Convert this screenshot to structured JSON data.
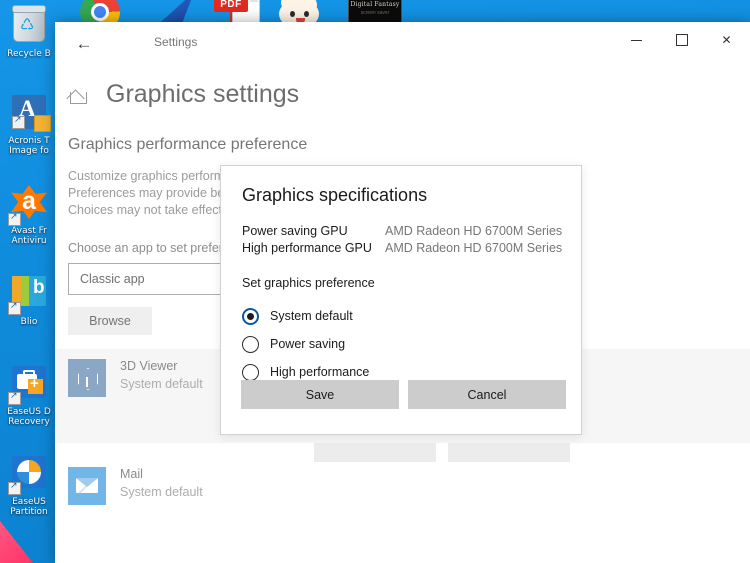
{
  "desktop": {
    "icons": [
      {
        "name": "Recycle Bin",
        "label": "Recycle B",
        "shape": "recycle-bin-icon"
      },
      {
        "name": "Acronis True Image",
        "label": "Acronis T\nImage fo",
        "shape": "acronis-icon"
      },
      {
        "name": "Avast Free Antivirus",
        "label": "Avast Fr\nAntiviru",
        "shape": "avast-icon"
      },
      {
        "name": "Blio",
        "label": "Blio",
        "shape": "blio-icon"
      },
      {
        "name": "EaseUS Data Recovery",
        "label": "EaseUS D\nRecovery",
        "shape": "easeus-recovery-icon"
      },
      {
        "name": "EaseUS Partition",
        "label": "EaseUS\nPartition",
        "shape": "easeus-partition-icon"
      }
    ],
    "top_icons": [
      {
        "name": "Google Chrome",
        "shape": "chrome-icon"
      },
      {
        "name": "Shark fin",
        "shape": "fin-icon"
      },
      {
        "name": "PDF document",
        "shape": "pdf-icon",
        "label": "PDF"
      },
      {
        "name": "Cloud mascot",
        "shape": "cloud-mascot-icon"
      },
      {
        "name": "Digital Fantasy",
        "shape": "digital-fantasy-tile",
        "label": "Digital Fantasy",
        "sublabel": "screen saver"
      }
    ]
  },
  "window": {
    "title": "Settings",
    "back_icon": "←",
    "minimize": "minimize-icon",
    "maximize": "maximize-icon",
    "close": "✕"
  },
  "page": {
    "title": "Graphics settings",
    "home_icon": "home-icon",
    "section_title": "Graphics performance preference",
    "description": "Customize graphics perform\nPreferences may provide bet\nChoices may not take effect",
    "choose_label": "Choose an app to set prefere",
    "combo_value": "Classic app",
    "browse_label": "Browse",
    "apps": [
      {
        "name": "3D Viewer",
        "status": "System default",
        "icon": "cube-icon",
        "selected": true
      },
      {
        "name": "Mail",
        "status": "System default",
        "icon": "envelope-icon",
        "selected": false
      }
    ]
  },
  "dialog": {
    "title": "Graphics specifications",
    "gpu_rows": [
      {
        "key": "Power saving GPU",
        "value": "AMD Radeon HD 6700M Series"
      },
      {
        "key": "High performance GPU",
        "value": "AMD Radeon HD 6700M Series"
      }
    ],
    "preference_label": "Set graphics preference",
    "options": [
      {
        "label": "System default",
        "selected": true
      },
      {
        "label": "Power saving",
        "selected": false
      },
      {
        "label": "High performance",
        "selected": false
      }
    ],
    "save_label": "Save",
    "cancel_label": "Cancel",
    "accent_color": "#0b57a4"
  }
}
